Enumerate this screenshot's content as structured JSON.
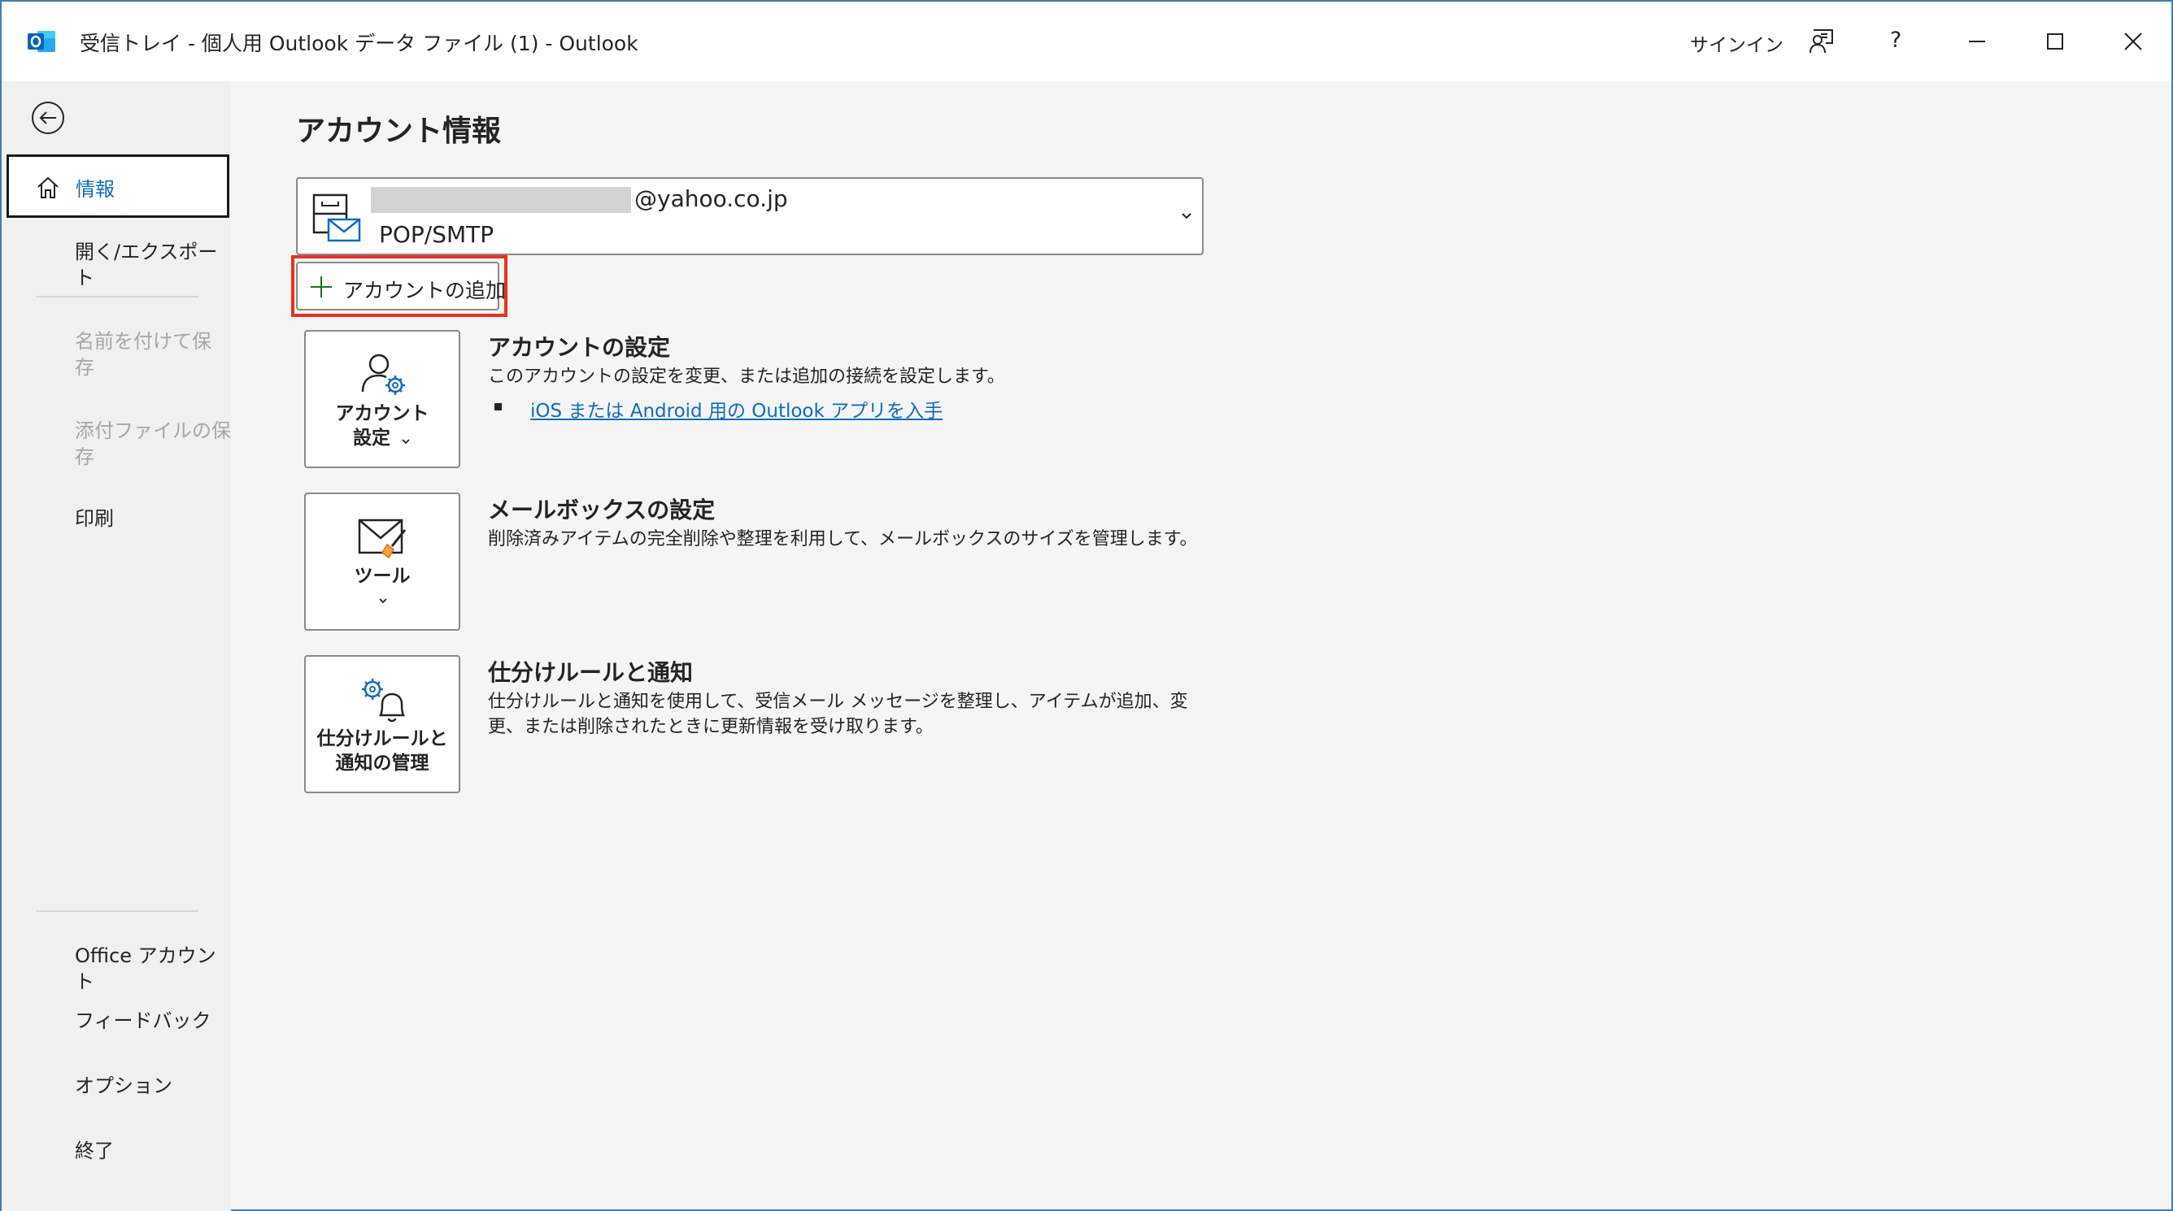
{
  "window": {
    "title": "受信トレイ - 個人用 Outlook データ ファイル (1)  -  Outlook",
    "signin_label": "サインイン",
    "help_label": "?",
    "accent_color": "#0f6cbd",
    "highlight_color": "#e8321f"
  },
  "nav": {
    "back_icon": "back-arrow-icon",
    "selected": {
      "icon": "home-icon",
      "label": "情報"
    },
    "items": [
      {
        "label": "開く/エクスポート",
        "enabled": true
      },
      {
        "label": "名前を付けて保\n存",
        "enabled": false
      },
      {
        "label": "添付ファイルの保\n存",
        "enabled": false
      },
      {
        "label": "印刷",
        "enabled": true
      }
    ],
    "bottom_items": [
      {
        "label": "Office アカウント"
      },
      {
        "label": "フィードバック"
      },
      {
        "label": "オプション"
      },
      {
        "label": "終了"
      }
    ]
  },
  "main": {
    "page_title": "アカウント情報",
    "account": {
      "email_suffix": "@yahoo.co.jp",
      "type": "POP/SMTP"
    },
    "add_account_label": "アカウントの追加",
    "sections": [
      {
        "tile_label_line1": "アカウント",
        "tile_label_line2": "設定",
        "title": "アカウントの設定",
        "description": "このアカウントの設定を変更、または追加の接続を設定します。",
        "link": "iOS または Android 用の Outlook アプリを入手"
      },
      {
        "tile_label_line1": "ツール",
        "title": "メールボックスの設定",
        "description": "削除済みアイテムの完全削除や整理を利用して、メールボックスのサイズを管理します。"
      },
      {
        "tile_label_line1": "仕分けルールと",
        "tile_label_line2": "通知の管理",
        "title": "仕分けルールと通知",
        "description": "仕分けルールと通知を使用して、受信メール メッセージを整理し、アイテムが追加、変更、または削除されたときに更新情報を受け取ります。"
      }
    ]
  }
}
